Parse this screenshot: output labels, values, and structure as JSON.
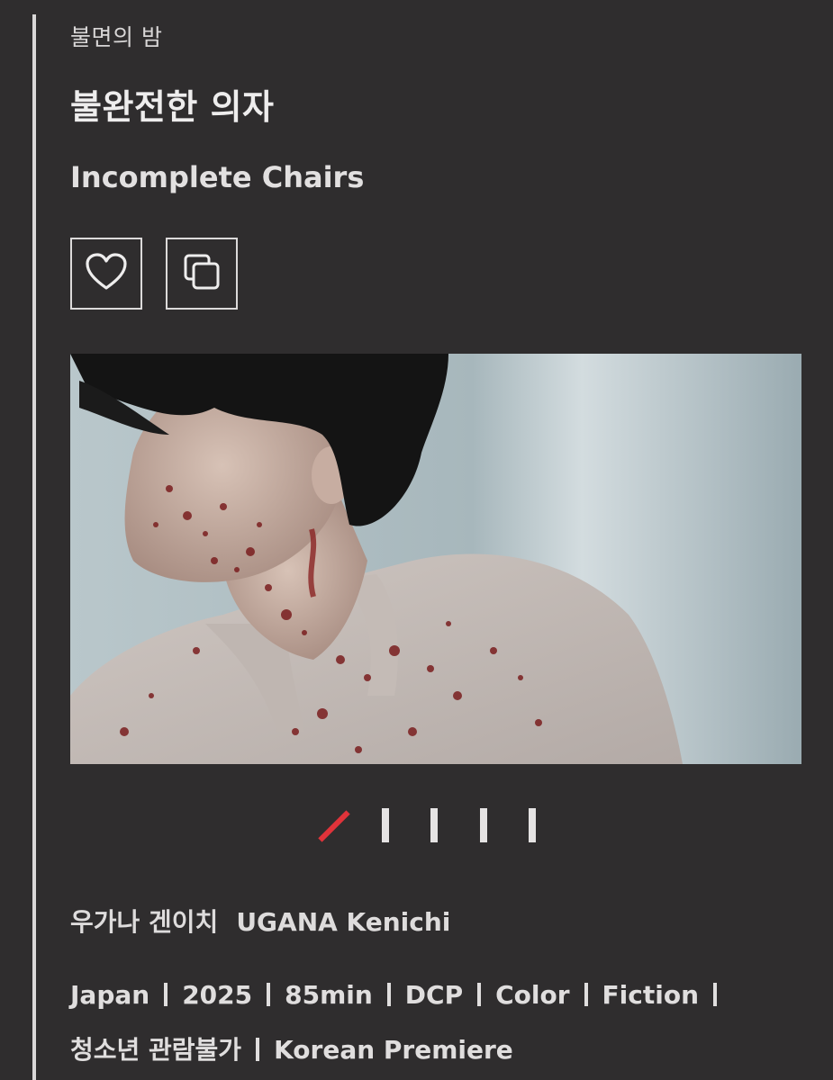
{
  "section": {
    "label": "불면의 밤"
  },
  "film": {
    "title_ko": "불완전한 의자",
    "title_en": "Incomplete Chairs"
  },
  "actions": {
    "favorite_icon": "heart-icon",
    "copy_icon": "copy-icon"
  },
  "gallery": {
    "image": "film-still",
    "slides_total": 5,
    "active_slide": 1,
    "active_color": "#e0333a"
  },
  "director": {
    "name_ko": "우가나 겐이치",
    "name_en": "UGANA Kenichi"
  },
  "meta": {
    "country": "Japan",
    "year": "2025",
    "runtime": "85min",
    "format": "DCP",
    "color": "Color",
    "genre": "Fiction",
    "rating": "청소년 관람불가",
    "premiere": "Korean Premiere"
  },
  "colors": {
    "background": "#2f2d2e",
    "text": "#e6e4e4",
    "accent": "#e0333a"
  }
}
